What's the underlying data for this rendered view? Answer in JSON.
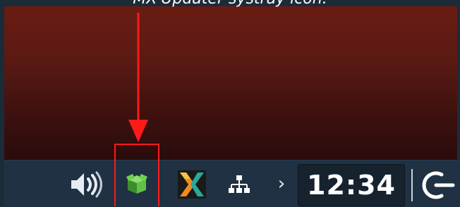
{
  "annotation": {
    "caption": "MX-Updater systray icon.",
    "highlight_color": "#ff1a1a"
  },
  "wallpaper": {
    "top_color": "#6a1c12",
    "bottom_color": "#2a0c0c"
  },
  "panel": {
    "background": "#1f3142",
    "tray_icons": [
      {
        "name": "volume-icon"
      },
      {
        "name": "mx-updater-icon"
      },
      {
        "name": "kde-connect-icon"
      },
      {
        "name": "network-icon"
      },
      {
        "name": "chevron-right-icon"
      }
    ],
    "chevron_glyph": "›",
    "clock": {
      "time": "12:34"
    },
    "logout_icon": "power-icon"
  }
}
